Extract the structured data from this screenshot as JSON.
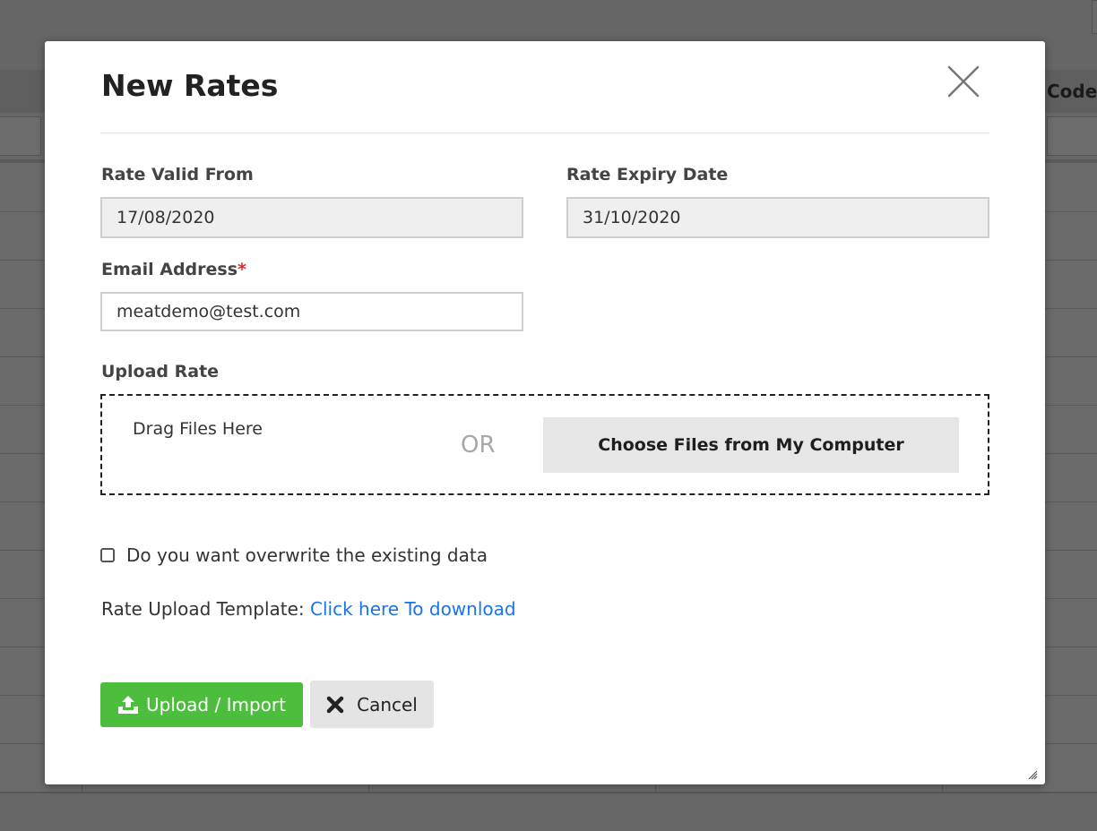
{
  "background": {
    "header_column_label": "Code"
  },
  "modal": {
    "title": "New Rates",
    "close_icon": "close-icon",
    "rate_valid_from": {
      "label": "Rate Valid From",
      "value": "17/08/2020"
    },
    "rate_expiry_date": {
      "label": "Rate Expiry Date",
      "value": "31/10/2020"
    },
    "email": {
      "label": "Email Address",
      "required_marker": "*",
      "value": "meatdemo@test.com"
    },
    "upload": {
      "label": "Upload Rate",
      "drag_text": "Drag Files Here",
      "or_text": "OR",
      "choose_button": "Choose Files from My Computer"
    },
    "overwrite_checkbox": {
      "label": "Do you want overwrite the existing data",
      "checked": false
    },
    "template": {
      "prefix": "Rate Upload Template:",
      "link_text": "Click here To download"
    },
    "buttons": {
      "upload_label": "Upload / Import",
      "upload_icon": "upload-icon",
      "cancel_label": "Cancel",
      "cancel_icon": "x-icon"
    },
    "colors": {
      "upload_green": "#4dbd3d",
      "link_blue": "#1a73e8",
      "required_red": "#d32f2f"
    }
  }
}
